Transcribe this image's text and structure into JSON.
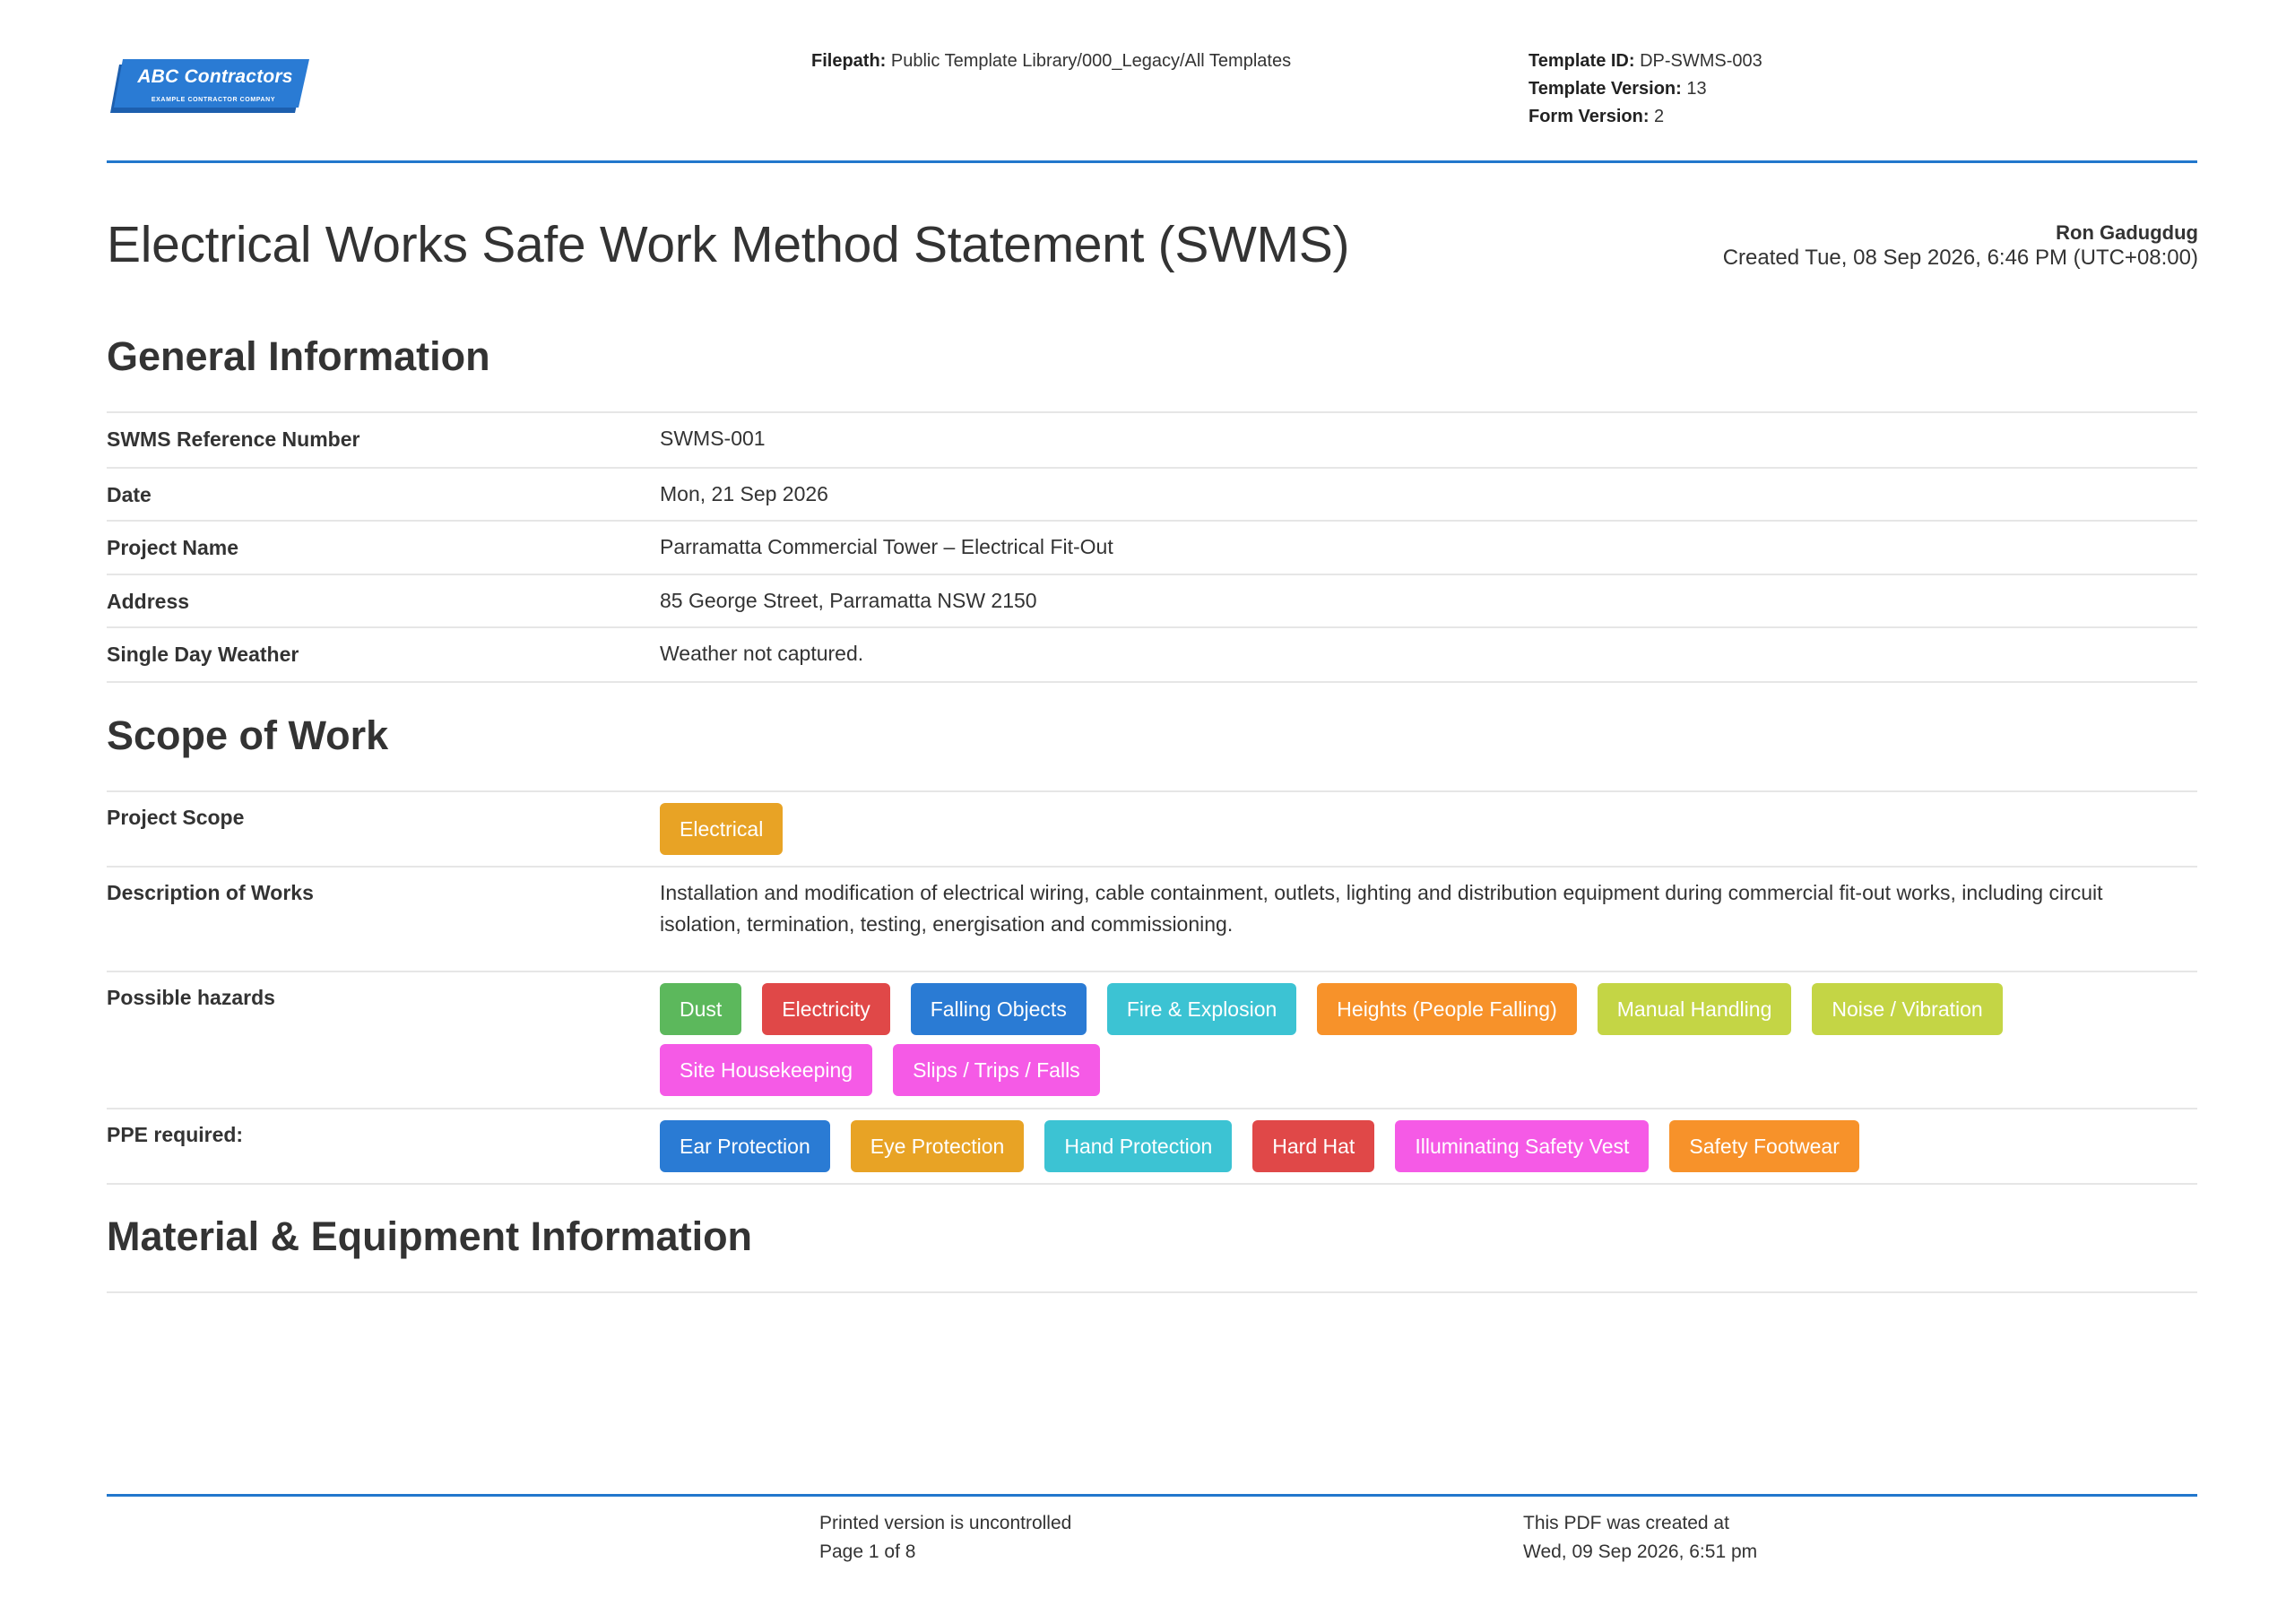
{
  "header": {
    "logo": {
      "name": "ABC Contractors",
      "tagline": "EXAMPLE CONTRACTOR COMPANY",
      "color": "#2a7bd4"
    },
    "filepath_label": "Filepath:",
    "filepath_value": "Public Template Library/000_Legacy/All Templates",
    "template_id_label": "Template ID:",
    "template_id_value": "DP-SWMS-003",
    "template_version_label": "Template Version:",
    "template_version_value": "13",
    "form_version_label": "Form Version:",
    "form_version_value": "2"
  },
  "document": {
    "title": "Electrical Works Safe Work Method Statement (SWMS)",
    "author": "Ron Gadugdug",
    "created": "Created Tue, 08 Sep 2026, 6:46 PM (UTC+08:00)"
  },
  "general": {
    "title": "General Information",
    "fields": [
      {
        "label": "SWMS Reference Number",
        "value": "SWMS-001"
      },
      {
        "label": "Date",
        "value": "Mon, 21 Sep 2026"
      },
      {
        "label": "Project Name",
        "value": "Parramatta Commercial Tower – Electrical Fit-Out"
      },
      {
        "label": "Address",
        "value": "85 George Street, Parramatta NSW 2150"
      },
      {
        "label": "Single Day Weather",
        "value": "Weather not captured."
      }
    ]
  },
  "scope": {
    "title": "Scope of Work",
    "project_scope_label": "Project Scope",
    "project_scope_tags": [
      {
        "label": "Electrical",
        "color": "#e8a325"
      }
    ],
    "description_label": "Description of Works",
    "description_value": "Installation and modification of electrical wiring, cable containment, outlets, lighting and distribution equipment during commercial fit-out works, including circuit isolation, termination, testing, energisation and commissioning.",
    "hazards_label": "Possible hazards",
    "hazards": [
      {
        "label": "Dust",
        "color": "#5cb85c"
      },
      {
        "label": "Electricity",
        "color": "#e04848"
      },
      {
        "label": "Falling Objects",
        "color": "#2a7bd4"
      },
      {
        "label": "Fire & Explosion",
        "color": "#3cc3d3"
      },
      {
        "label": "Heights (People Falling)",
        "color": "#f7922a"
      },
      {
        "label": "Manual Handling",
        "color": "#c4d545"
      },
      {
        "label": "Noise / Vibration",
        "color": "#c4d545"
      },
      {
        "label": "Site Housekeeping",
        "color": "#f55ae6"
      },
      {
        "label": "Slips / Trips / Falls",
        "color": "#f55ae6"
      }
    ],
    "ppe_label": "PPE required:",
    "ppe": [
      {
        "label": "Ear Protection",
        "color": "#2a7bd4"
      },
      {
        "label": "Eye Protection",
        "color": "#e8a325"
      },
      {
        "label": "Hand Protection",
        "color": "#3cc3d3"
      },
      {
        "label": "Hard Hat",
        "color": "#e04848"
      },
      {
        "label": "Illuminating Safety Vest",
        "color": "#f55ae6"
      },
      {
        "label": "Safety Footwear",
        "color": "#f7922a"
      }
    ]
  },
  "materials": {
    "title": "Material & Equipment Information"
  },
  "footer": {
    "uncontrolled": "Printed version is uncontrolled",
    "page": "Page 1 of 8",
    "created_label": "This PDF was created at",
    "created_value": "Wed, 09 Sep 2026, 6:51 pm"
  }
}
